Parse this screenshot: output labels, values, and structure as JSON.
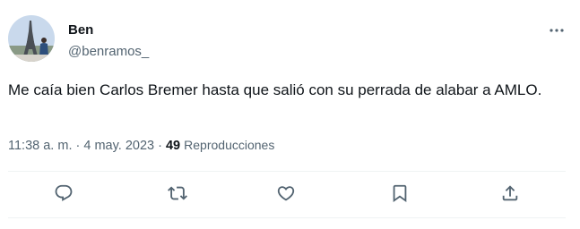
{
  "author": {
    "name": "Ben",
    "handle": "@benramos_"
  },
  "tweet": {
    "text": "Me caía bien Carlos Bremer hasta que salió con su perrada de alabar a AMLO."
  },
  "meta": {
    "time": "11:38 a. m.",
    "separator1": " · ",
    "date": "4 may. 2023",
    "separator2": " · ",
    "views_count": "49",
    "views_label": "Reproducciones"
  },
  "icons": {
    "more": "more-horizontal-icon",
    "reply": "reply-icon",
    "retweet": "retweet-icon",
    "like": "heart-icon",
    "bookmark": "bookmark-icon",
    "share": "share-icon"
  },
  "colors": {
    "text_primary": "#0f1419",
    "text_secondary": "#536471",
    "divider": "#eff3f4"
  }
}
